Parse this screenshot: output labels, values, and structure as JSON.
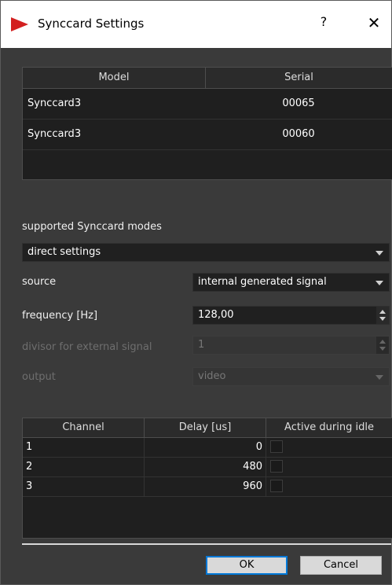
{
  "window": {
    "title": "Synccard Settings",
    "help_label": "?",
    "close_label": "✕",
    "accent_color": "#d32020"
  },
  "device_table": {
    "columns": [
      "Model",
      "Serial"
    ],
    "rows": [
      {
        "model": "Synccard3",
        "serial": "00065"
      },
      {
        "model": "Synccard3",
        "serial": "00060"
      }
    ]
  },
  "modes": {
    "label": "supported Synccard modes",
    "value": "direct settings"
  },
  "source": {
    "label": "source",
    "value": "internal generated signal"
  },
  "frequency": {
    "label": "frequency [Hz]",
    "value": "128,00"
  },
  "divisor": {
    "label": "divisor for external signal",
    "value": "1",
    "disabled": true
  },
  "output": {
    "label": "output",
    "value": "video",
    "disabled": true
  },
  "channel_table": {
    "columns": [
      "Channel",
      "Delay [us]",
      "Active during idle"
    ],
    "rows": [
      {
        "channel": "1",
        "delay": "0",
        "active": false
      },
      {
        "channel": "2",
        "delay": "480",
        "active": false
      },
      {
        "channel": "3",
        "delay": "960",
        "active": false
      }
    ]
  },
  "buttons": {
    "ok": "OK",
    "cancel": "Cancel"
  }
}
